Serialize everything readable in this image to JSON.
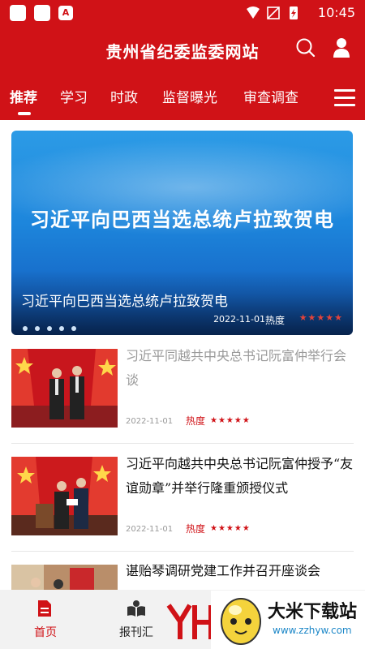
{
  "status_bar": {
    "time": "10:45"
  },
  "header": {
    "title": "贵州省纪委监委网站"
  },
  "tabs": [
    "推荐",
    "学习",
    "时政",
    "监督曝光",
    "审查调查"
  ],
  "banner": {
    "big_text": "习近平向巴西当选总统卢拉致贺电",
    "caption": "习近平向巴西当选总统卢拉致贺电",
    "date": "2022-11-01",
    "heat_label": "热度",
    "stars": "★★★★★"
  },
  "news": [
    {
      "title": "习近平同越共中央总书记阮富仲举行会谈",
      "date": "2022-11-01",
      "heat_label": "热度",
      "stars": "★★★★★"
    },
    {
      "title": "习近平向越共中央总书记阮富仲授予“友谊勋章”并举行隆重颁授仪式",
      "date": "2022-11-01",
      "heat_label": "热度",
      "stars": "★★★★★"
    },
    {
      "title": "谌贻琴调研党建工作并召开座谈会"
    }
  ],
  "bottom_nav": [
    {
      "label": "首页",
      "icon": "document-icon"
    },
    {
      "label": "报刊汇",
      "icon": "book-icon"
    }
  ],
  "watermark": {
    "brand": "大米下载站",
    "url": "www.zzhyw.com",
    "logo_text": "YH"
  },
  "colors": {
    "primary": "#d01217",
    "nav_bg": "#f2f2f2",
    "banner_blue": "#1d86dc"
  }
}
